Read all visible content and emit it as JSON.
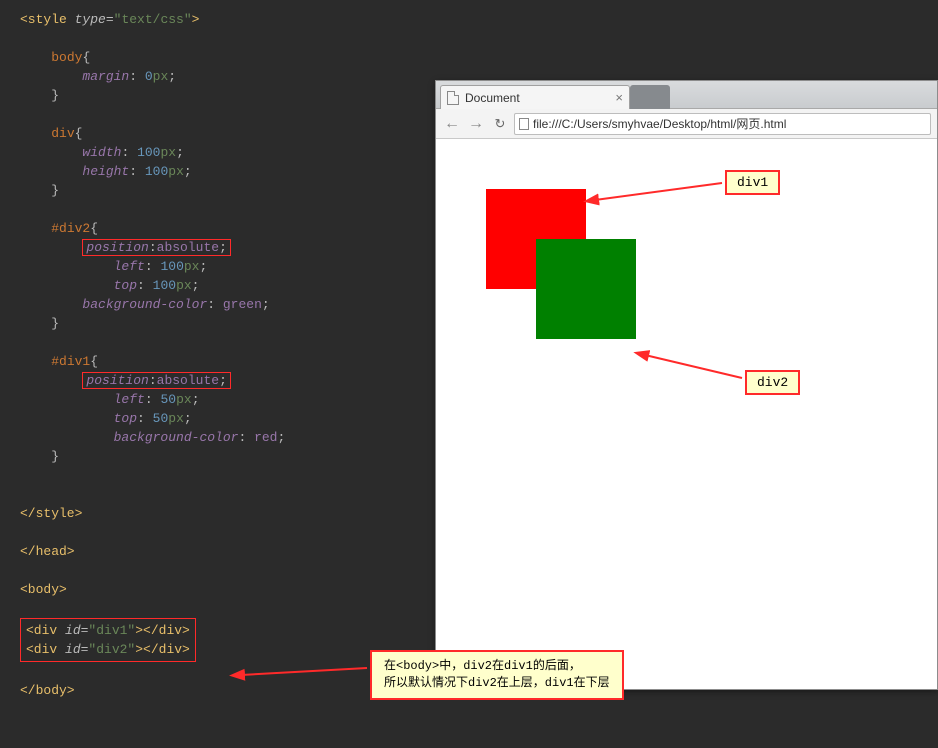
{
  "code": {
    "style_open": "<style type=",
    "style_type": "\"text/css\"",
    "style_open_end": ">",
    "body_sel": "body",
    "margin_prop": "margin",
    "margin_val": "0",
    "px": "px",
    "div_sel": "div",
    "width_prop": "width",
    "width_val": "100",
    "height_prop": "height",
    "height_val": "100",
    "div2_sel": "#div2",
    "pos_prop": "position",
    "pos_val": "absolute",
    "left_prop": "left",
    "left2_val": "100",
    "top_prop": "top",
    "top2_val": "100",
    "bg_prop": "background-color",
    "bg2_val": "green",
    "div1_sel": "#div1",
    "left1_val": "50",
    "top1_val": "50",
    "bg1_val": "red",
    "style_close": "</style>",
    "head_close": "</head>",
    "body_open": "<body>",
    "divline1_a": "<div ",
    "id_attr": "id=",
    "id1_val": "\"div1\"",
    "id2_val": "\"div2\"",
    "divline_mid": "></",
    "divline_end": "div>",
    "body_close": "</body>"
  },
  "browser": {
    "tab_title": "Document",
    "url": "file:///C:/Users/smyhvae/Desktop/html/网页.html"
  },
  "labels": {
    "div1": "div1",
    "div2": "div2"
  },
  "callout": {
    "line1": "在<body>中，div2在div1的后面，",
    "line2": "所以默认情况下div2在上层，div1在下层"
  }
}
